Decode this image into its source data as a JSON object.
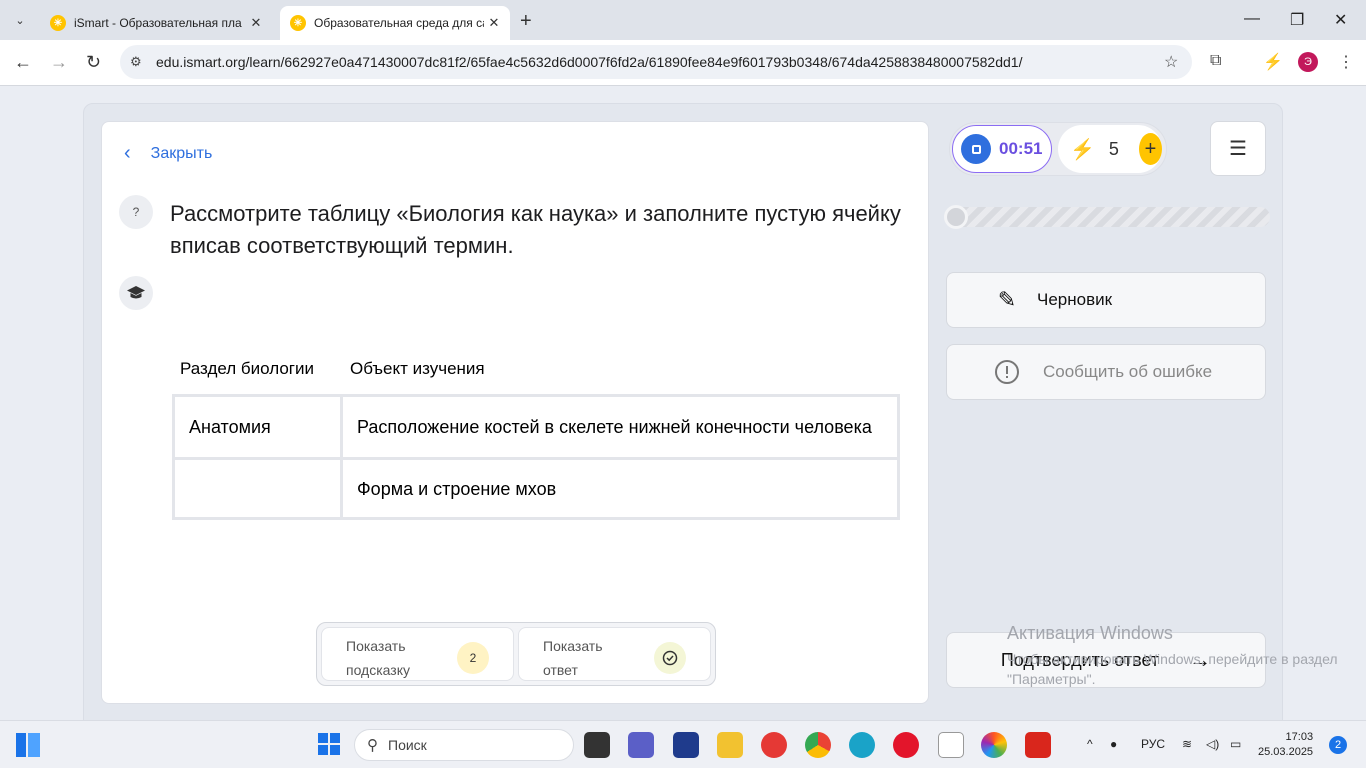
{
  "browser": {
    "tabs": [
      {
        "title": "iSmart - Образовательная пла",
        "active": false
      },
      {
        "title": "Образовательная среда для са",
        "active": true
      }
    ],
    "url": "edu.ismart.org/learn/662927e0a471430007dc81f2/65fae4c5632d6d0007f6fd2a/61890fee84e9f601793b0348/674da4258838480007582dd1/",
    "profile_initial": "Э"
  },
  "lesson": {
    "close_label": "Закрыть",
    "help_icon_text": "?",
    "question": "Рассмотрите таблицу «Биология как наука» и заполните пустую ячейку вписав соответствующий термин.",
    "table": {
      "headers": [
        "Раздел биологии",
        "Объект изучения"
      ],
      "rows": [
        [
          "Анатомия",
          "Расположение костей в скелете нижней конечности человека"
        ],
        [
          "",
          "Форма и строение мхов"
        ]
      ]
    },
    "hint_button": {
      "label": "Показать подсказку",
      "count": "2"
    },
    "answer_button": {
      "label": "Показать ответ"
    }
  },
  "side": {
    "timer": "00:51",
    "energy": "5",
    "draft_label": "Черновик",
    "report_label": "Сообщить об ошибке",
    "confirm_label": "Подтвердить ответ",
    "progress_percent": 0
  },
  "watermark": {
    "title": "Активация Windows",
    "text": "Чтобы активировать Windows, перейдите в раздел \"Параметры\"."
  },
  "taskbar": {
    "search_label": "Поиск",
    "lang": "РУС",
    "time": "17:03",
    "date": "25.03.2025",
    "notifications": "2"
  },
  "colors": {
    "accent": "#2f6fde",
    "timer_text": "#6a4fe0",
    "energy": "#ffc400"
  }
}
